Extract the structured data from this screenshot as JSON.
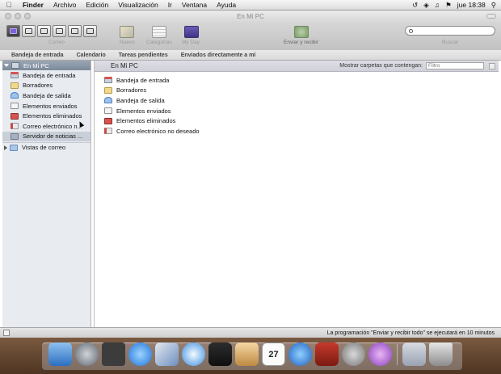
{
  "menubar": {
    "apple_icon": "apple-icon",
    "items": [
      "Finder",
      "Archivo",
      "Edición",
      "Visualización",
      "Ir",
      "Ventana",
      "Ayuda"
    ],
    "clock": "jue 18:38"
  },
  "window": {
    "title": "En Mi PC"
  },
  "toolbar": {
    "view_label": "Correo",
    "new_label": "Nuevo",
    "categories_label": "Categorías",
    "myday_label": "My Day",
    "send_receive_label": "Enviar y recibir",
    "search_label": "Buscar",
    "search_value": ""
  },
  "tabs": [
    "Bandeja de entrada",
    "Calendario",
    "Tareas pendientes",
    "Enviados directamente a mí"
  ],
  "sidebar": {
    "root": "En Mi PC",
    "items": [
      {
        "label": "Bandeja de entrada",
        "icon": "inbox-icon"
      },
      {
        "label": "Borradores",
        "icon": "drafts-icon"
      },
      {
        "label": "Bandeja de salida",
        "icon": "outbox-icon"
      },
      {
        "label": "Elementos enviados",
        "icon": "sent-icon"
      },
      {
        "label": "Elementos eliminados",
        "icon": "deleted-icon"
      },
      {
        "label": "Correo electrónico n...",
        "icon": "junk-icon"
      },
      {
        "label": "Servidor de noticias ...",
        "icon": "news-server-icon"
      }
    ],
    "views": "Vistas de correo"
  },
  "main": {
    "header": "En Mi PC",
    "filter_label": "Mostrar carpetas que contengan:",
    "filter_placeholder": "Filtro",
    "folders": [
      {
        "label": "Bandeja de entrada",
        "icon": "inbox-icon"
      },
      {
        "label": "Borradores",
        "icon": "drafts-icon"
      },
      {
        "label": "Bandeja de salida",
        "icon": "outbox-icon"
      },
      {
        "label": "Elementos enviados",
        "icon": "sent-icon"
      },
      {
        "label": "Elementos eliminados",
        "icon": "deleted-icon"
      },
      {
        "label": "Correo electrónico no deseado",
        "icon": "junk-icon"
      }
    ]
  },
  "status": {
    "message": "La programación \"Enviar y recibir todo\" se ejecutará en 10 minutos"
  },
  "dock": {
    "calendar_day": "27"
  }
}
